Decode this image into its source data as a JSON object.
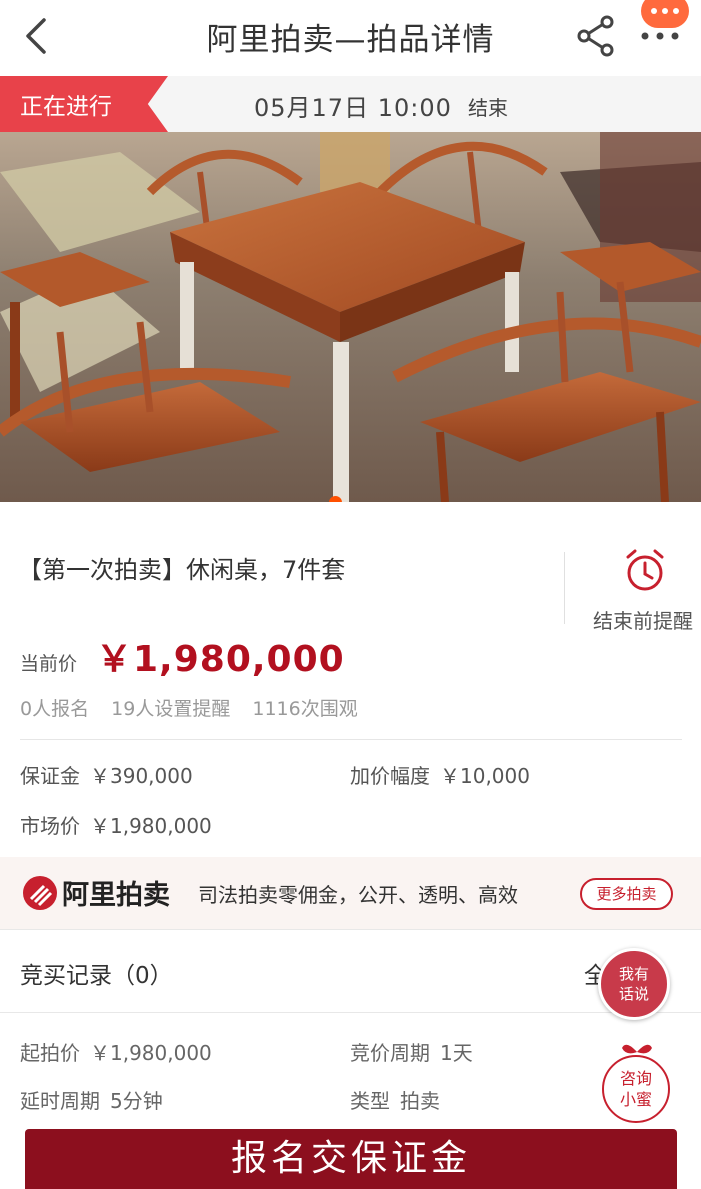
{
  "nav": {
    "title": "阿里拍卖—拍品详情",
    "back_icon": "chevron-left-icon",
    "share_icon": "share-icon",
    "more_icon": "more-dots-icon"
  },
  "status": {
    "tag": "正在进行",
    "end_time": "05月17日 10:00",
    "end_word": "结束"
  },
  "hero": {
    "image_alt": "休闲桌 7件套 photo",
    "carousel_index": 1
  },
  "item": {
    "title": "【第一次拍卖】休闲桌，7件套",
    "remind_label": "结束前提醒",
    "price_label": "当前价",
    "price": "￥1,980,000",
    "stats": [
      "0人报名",
      "19人设置提醒",
      "1116次围观"
    ],
    "deposit_label": "保证金",
    "deposit_value": "￥390,000",
    "increment_label": "加价幅度",
    "increment_value": "￥10,000",
    "market_label": "市场价",
    "market_value": "￥1,980,000"
  },
  "banner": {
    "brand": "阿里拍卖",
    "slogan": "司法拍卖零佣金，公开、透明、高效",
    "more_button": "更多拍卖"
  },
  "bids": {
    "title": "竞买记录（0）",
    "all_label": "全部"
  },
  "rules": {
    "start_price_label": "起拍价",
    "start_price_value": "￥1,980,000",
    "period_label": "竞价周期",
    "period_value": "1天",
    "delay_label": "延时周期",
    "delay_value": "5分钟",
    "type_label": "类型",
    "type_value": "拍卖"
  },
  "float": {
    "talk_line1": "我有",
    "talk_line2": "话说",
    "consult_line1": "咨询",
    "consult_line2": "小蜜"
  },
  "cta": {
    "label": "报名交保证金"
  },
  "colors": {
    "accent_red": "#b2101f",
    "tag_red": "#e8424a",
    "cta": "#8c0f1e",
    "orange_dot": "#ff5000"
  }
}
